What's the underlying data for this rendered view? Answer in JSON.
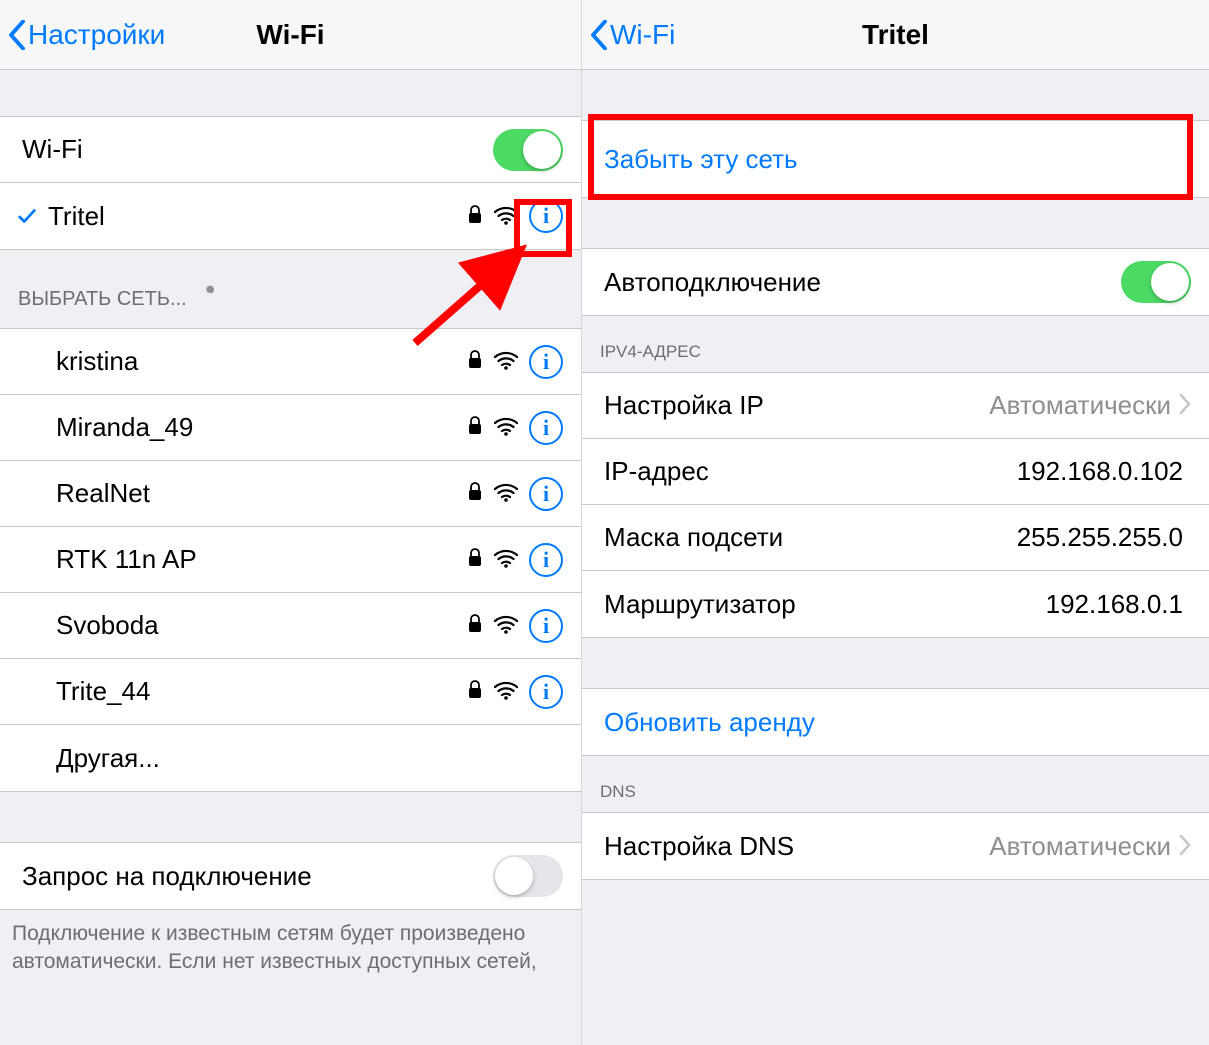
{
  "left": {
    "back_label": "Настройки",
    "title": "Wi-Fi",
    "wifi_row_label": "Wi-Fi",
    "wifi_on": true,
    "connected_network": "Tritel",
    "choose_header": "ВЫБРАТЬ СЕТЬ...",
    "networks": [
      {
        "name": "kristina",
        "secured": true
      },
      {
        "name": "Miranda_49",
        "secured": true
      },
      {
        "name": "RealNet",
        "secured": true
      },
      {
        "name": "RTK 11n AP",
        "secured": true
      },
      {
        "name": "Svoboda",
        "secured": true
      },
      {
        "name": "Trite_44",
        "secured": true
      }
    ],
    "other_label": "Другая...",
    "ask_join_label": "Запрос на подключение",
    "ask_join_on": false,
    "footer": "Подключение к известным сетям будет произведено автоматически. Если нет известных доступных сетей,"
  },
  "right": {
    "back_label": "Wi-Fi",
    "title": "Tritel",
    "forget_label": "Забыть эту сеть",
    "autojoin_label": "Автоподключение",
    "autojoin_on": true,
    "ipv4_header": "IPV4-АДРЕС",
    "ip_config": {
      "label": "Настройка IP",
      "value": "Автоматически"
    },
    "ip_addr": {
      "label": "IP-адрес",
      "value": "192.168.0.102"
    },
    "subnet": {
      "label": "Маска подсети",
      "value": "255.255.255.0"
    },
    "router": {
      "label": "Маршрутизатор",
      "value": "192.168.0.1"
    },
    "renew_label": "Обновить аренду",
    "dns_header": "DNS",
    "dns_config": {
      "label": "Настройка DNS",
      "value": "Автоматически"
    }
  }
}
